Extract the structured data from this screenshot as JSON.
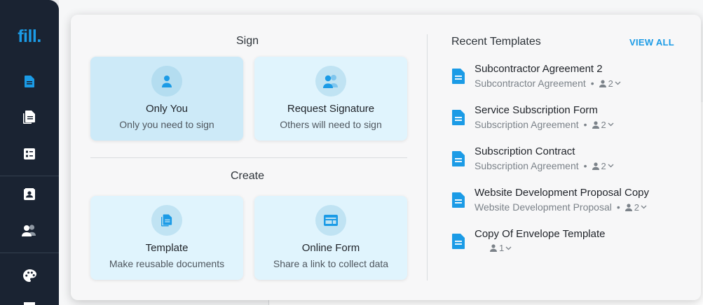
{
  "app": {
    "logo": "fill."
  },
  "sidebar": {
    "icons": [
      "document-icon",
      "documents-icon",
      "form-list-icon",
      "contacts-book-icon",
      "users-icon",
      "palette-icon"
    ]
  },
  "sign_section": {
    "title": "Sign",
    "cards": [
      {
        "title": "Only You",
        "subtitle": "Only you need to sign",
        "icon": "person-icon"
      },
      {
        "title": "Request Signature",
        "subtitle": "Others will need to sign",
        "icon": "people-icon"
      }
    ]
  },
  "create_section": {
    "title": "Create",
    "cards": [
      {
        "title": "Template",
        "subtitle": "Make reusable documents",
        "icon": "template-icon"
      },
      {
        "title": "Online Form",
        "subtitle": "Share a link to collect data",
        "icon": "online-form-icon"
      }
    ]
  },
  "recent": {
    "title": "Recent Templates",
    "view_all": "VIEW ALL",
    "items": [
      {
        "name": "Subcontractor Agreement 2",
        "category": "Subcontractor Agreement",
        "dot": "•",
        "signers": "2"
      },
      {
        "name": "Service Subscription Form",
        "category": "Subscription Agreement",
        "dot": "•",
        "signers": "2"
      },
      {
        "name": "Subscription Contract",
        "category": "Subscription Agreement",
        "dot": "•",
        "signers": "2"
      },
      {
        "name": "Website Development Proposal Copy",
        "category": "Website Development Proposal",
        "dot": "•",
        "signers": "2"
      },
      {
        "name": "Copy Of Envelope Template",
        "category": "",
        "dot": "",
        "signers": "1"
      }
    ]
  },
  "colors": {
    "accent": "#1b9be6",
    "sidebar": "#1a2332",
    "card": "#e0f4fd",
    "card_active": "#cdeaf8"
  }
}
